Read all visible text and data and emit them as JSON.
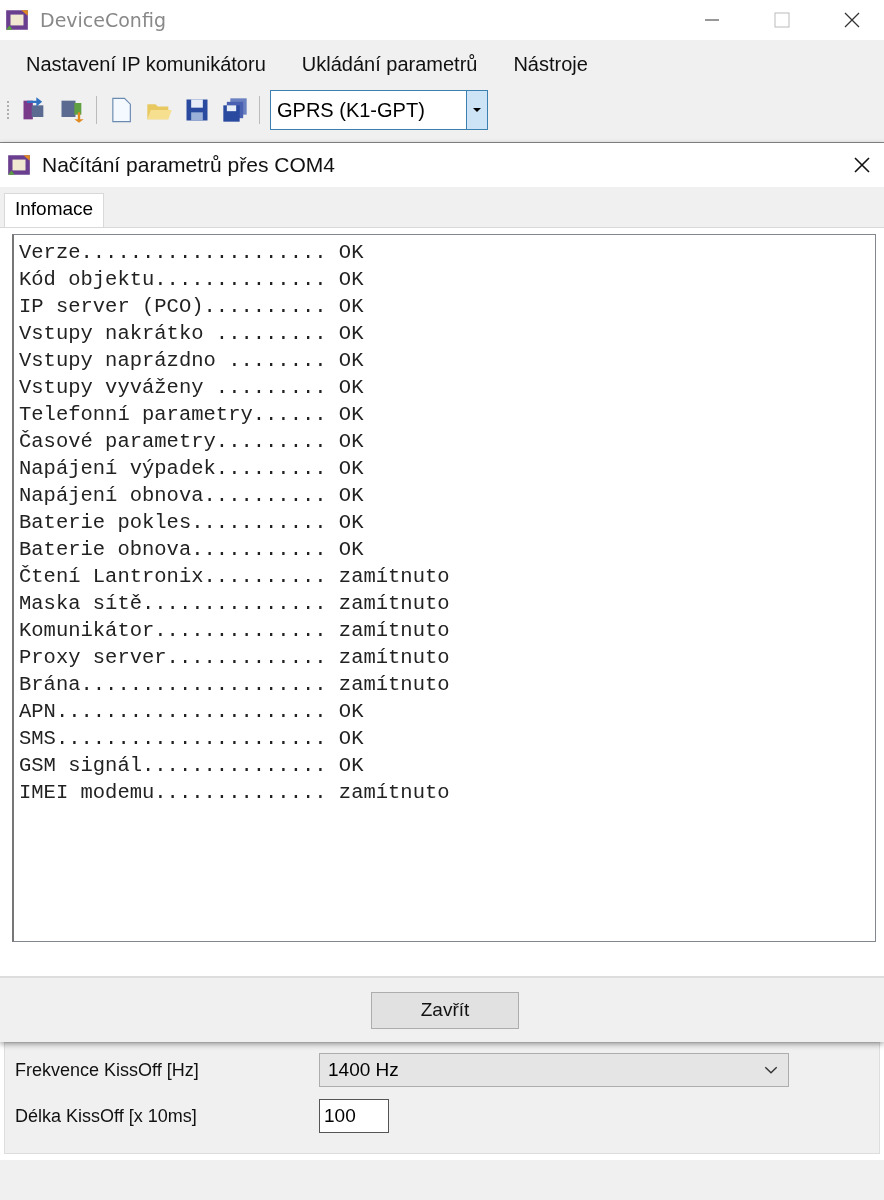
{
  "window": {
    "title": "DeviceConfig"
  },
  "menu": [
    "Nastavení IP komunikátoru",
    "Ukládání parametrů",
    "Nástroje"
  ],
  "toolbar": {
    "mode": "GPRS (K1-GPT)"
  },
  "dialog": {
    "title": "Načítání parametrů přes COM4",
    "tabs": [
      {
        "label": "Infomace",
        "selected": true
      }
    ],
    "log": [
      "Verze.................... OK",
      "Kód objektu.............. OK",
      "IP server (PCO).......... OK",
      "Vstupy nakrátko ......... OK",
      "Vstupy naprázdno ........ OK",
      "Vstupy vyváženy ......... OK",
      "Telefonní parametry...... OK",
      "Časové parametry......... OK",
      "Napájení výpadek......... OK",
      "Napájení obnova.......... OK",
      "Baterie pokles........... OK",
      "Baterie obnova........... OK",
      "Čtení Lantronix.......... zamítnuto",
      "Maska sítě............... zamítnuto",
      "Komunikátor.............. zamítnuto",
      "Proxy server............. zamítnuto",
      "Brána.................... zamítnuto",
      "APN...................... OK",
      "SMS...................... OK",
      "GSM signál............... OK",
      "IMEI modemu.............. zamítnuto"
    ],
    "button": "Zavřít"
  },
  "settings": [
    {
      "kind": "select",
      "label": "Frekvence KissOff [Hz]",
      "value": "1400 Hz"
    },
    {
      "kind": "input",
      "label": "Délka KissOff [x 10ms]",
      "value": "100"
    }
  ]
}
